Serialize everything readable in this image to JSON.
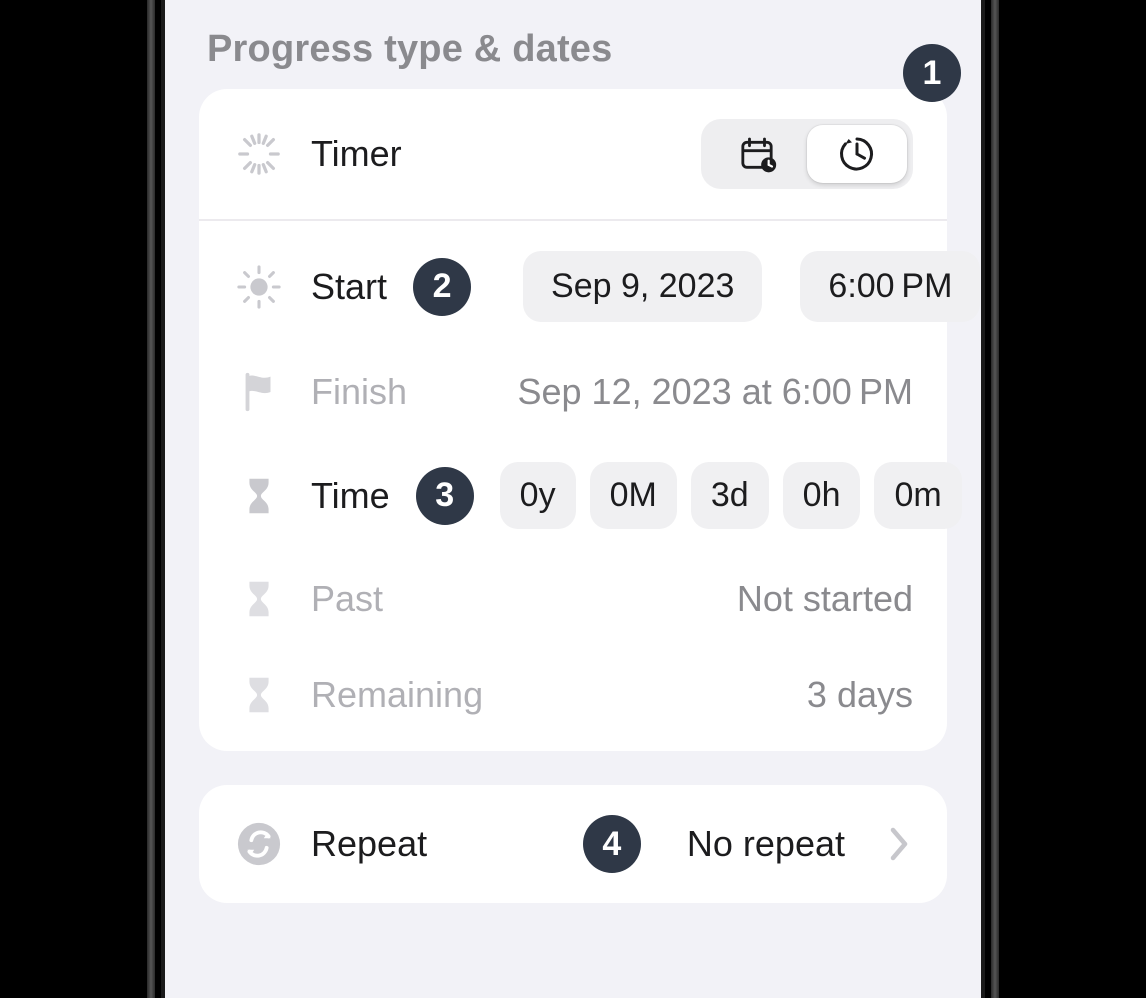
{
  "section_header": "Progress type & dates",
  "badges": {
    "b1": "1",
    "b2": "2",
    "b3": "3",
    "b4": "4"
  },
  "timer_row": {
    "label": "Timer"
  },
  "start": {
    "label": "Start",
    "date": "Sep 9, 2023",
    "time": "6:00 PM"
  },
  "finish": {
    "label": "Finish",
    "value": "Sep 12, 2023 at 6:00 PM"
  },
  "duration": {
    "label": "Time",
    "y": "0y",
    "M": "0M",
    "d": "3d",
    "h": "0h",
    "m": "0m"
  },
  "past": {
    "label": "Past",
    "value": "Not started"
  },
  "remaining": {
    "label": "Remaining",
    "value": "3 days"
  },
  "repeat": {
    "label": "Repeat",
    "value": "No repeat"
  }
}
